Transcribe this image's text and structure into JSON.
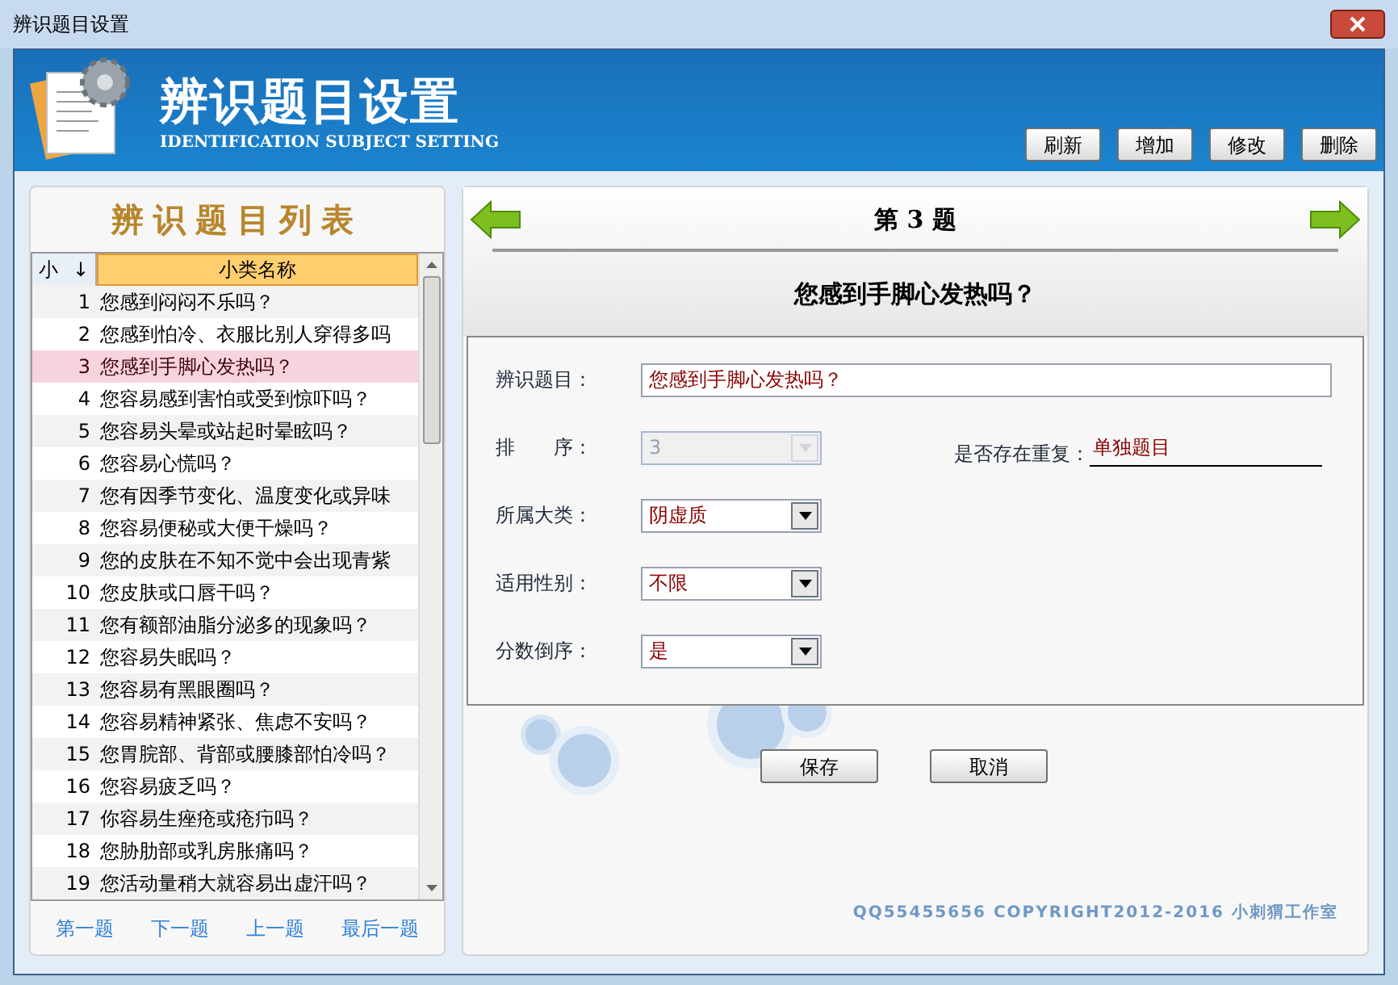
{
  "window": {
    "title": "辨识题目设置"
  },
  "header": {
    "title": "辨识题目设置",
    "subtitle": "IDENTIFICATION SUBJECT SETTING",
    "buttons": [
      "刷新",
      "增加",
      "修改",
      "删除"
    ]
  },
  "list": {
    "title": "辨识题目列表",
    "columns": [
      "小",
      "小类名称"
    ],
    "sort_mark": "↓",
    "rows": [
      {
        "no": "1",
        "name": "您感到闷闷不乐吗？",
        "selected": false
      },
      {
        "no": "2",
        "name": "您感到怕冷、衣服比别人穿得多吗",
        "selected": false
      },
      {
        "no": "3",
        "name": "您感到手脚心发热吗？",
        "selected": true
      },
      {
        "no": "4",
        "name": "您容易感到害怕或受到惊吓吗？",
        "selected": false
      },
      {
        "no": "5",
        "name": "您容易头晕或站起时晕眩吗？",
        "selected": false
      },
      {
        "no": "6",
        "name": "您容易心慌吗？",
        "selected": false
      },
      {
        "no": "7",
        "name": "您有因季节变化、温度变化或异味",
        "selected": false
      },
      {
        "no": "8",
        "name": "您容易便秘或大便干燥吗？",
        "selected": false
      },
      {
        "no": "9",
        "name": "您的皮肤在不知不觉中会出现青紫",
        "selected": false
      },
      {
        "no": "10",
        "name": "您皮肤或口唇干吗？",
        "selected": false
      },
      {
        "no": "11",
        "name": "您有额部油脂分泌多的现象吗？",
        "selected": false
      },
      {
        "no": "12",
        "name": "您容易失眠吗？",
        "selected": false
      },
      {
        "no": "13",
        "name": "您容易有黑眼圈吗？",
        "selected": false
      },
      {
        "no": "14",
        "name": "您容易精神紧张、焦虑不安吗？",
        "selected": false
      },
      {
        "no": "15",
        "name": "您胃脘部、背部或腰膝部怕冷吗？",
        "selected": false
      },
      {
        "no": "16",
        "name": "您容易疲乏吗？",
        "selected": false
      },
      {
        "no": "17",
        "name": "你容易生痤疮或疮疖吗？",
        "selected": false
      },
      {
        "no": "18",
        "name": "您胁肋部或乳房胀痛吗？",
        "selected": false
      },
      {
        "no": "19",
        "name": "您活动量稍大就容易出虚汗吗？",
        "selected": false
      }
    ],
    "nav": [
      "第一题",
      "下一题",
      "上一题",
      "最后一题"
    ]
  },
  "detail": {
    "heading": "第 3 题",
    "question": "您感到手脚心发热吗？",
    "fields": [
      {
        "kind": "text",
        "label": "辨识题目：",
        "value": "您感到手脚心发热吗？"
      },
      {
        "kind": "select",
        "label": "排　　序：",
        "value": "3",
        "disabled": true
      },
      {
        "kind": "select",
        "label": "所属大类：",
        "value": "阴虚质",
        "disabled": false
      },
      {
        "kind": "select",
        "label": "适用性别：",
        "value": "不限",
        "disabled": false
      },
      {
        "kind": "select",
        "label": "分数倒序：",
        "value": "是",
        "disabled": false
      }
    ],
    "repeat": {
      "label": "是否存在重复：",
      "value": "单独题目"
    },
    "buttons": [
      "保存",
      "取消"
    ],
    "copyright": "QQ55455656 COPYRIGHT2012-2016 小刺猬工作室"
  }
}
